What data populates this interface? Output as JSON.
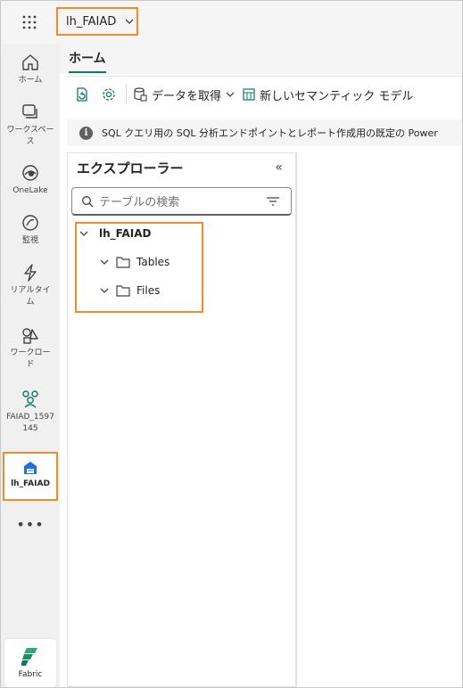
{
  "topbar": {
    "waffle_icon": "app-launcher-icon",
    "workspace_name": "lh_FAIAD"
  },
  "rail": {
    "items": [
      {
        "label": "ホーム",
        "icon": "home-icon"
      },
      {
        "label": "ワークスペース",
        "icon": "workspaces-icon"
      },
      {
        "label": "OneLake",
        "icon": "onelake-icon"
      },
      {
        "label": "監視",
        "icon": "monitor-icon"
      },
      {
        "label": "リアルタイム",
        "icon": "real-time-icon"
      },
      {
        "label": "ワークロード",
        "icon": "workloads-icon"
      },
      {
        "label": "FAIAD_1597145",
        "icon": "workspace-people-icon"
      }
    ],
    "active": {
      "label": "lh_FAIAD",
      "icon": "lakehouse-icon"
    },
    "more": "•••",
    "fabric_label": "Fabric"
  },
  "tabs": {
    "home": "ホーム"
  },
  "ribbon": {
    "get_data": "データを取得",
    "new_semantic_model": "新しいセマンティック モデル"
  },
  "info": {
    "text": "SQL クエリ用の SQL 分析エンドポイントとレポート作成用の既定の Power"
  },
  "explorer": {
    "title": "エクスプローラー",
    "search_placeholder": "テーブルの検索",
    "tree": {
      "root": "lh_FAIAD",
      "children": [
        "Tables",
        "Files"
      ]
    }
  },
  "colors": {
    "highlight": "#f28c28",
    "accent": "#117865"
  }
}
